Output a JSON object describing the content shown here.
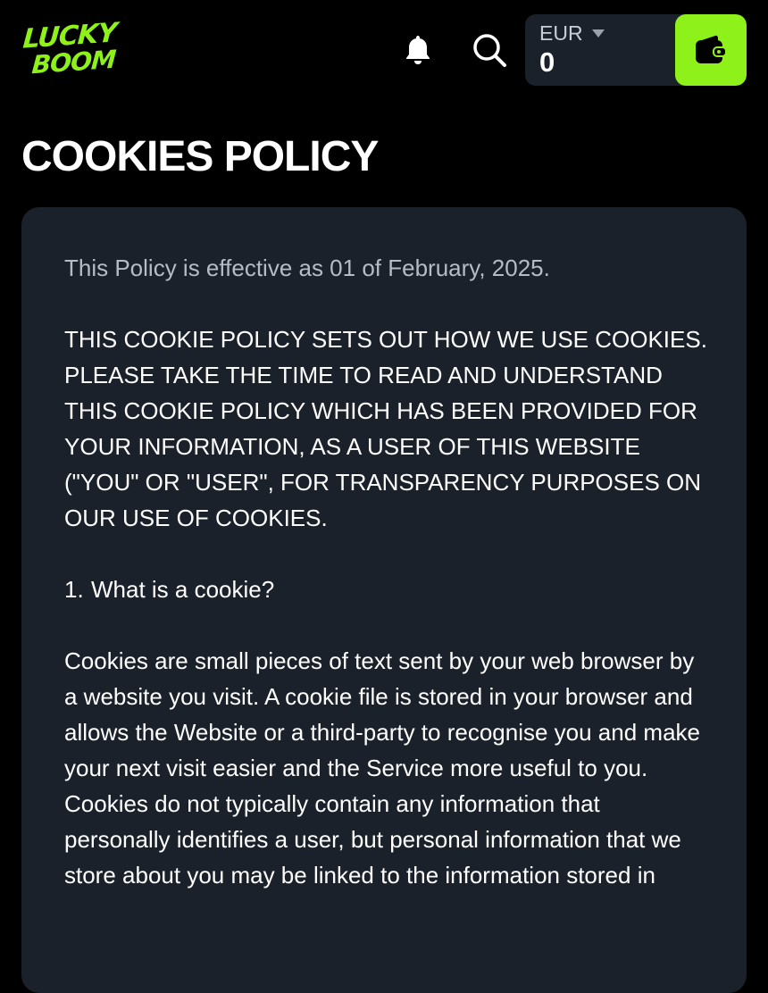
{
  "header": {
    "logo": {
      "line1": "LUCKY",
      "line2": "BOOM"
    },
    "bell_icon": "bell-icon",
    "search_icon": "search-icon",
    "wallet": {
      "currency": "EUR",
      "balance": "0",
      "wallet_icon": "wallet-icon",
      "accent_color": "#8ef21a"
    }
  },
  "page": {
    "title": "COOKIES POLICY",
    "effective": "This Policy is effective as 01 of February, 2025.",
    "intro_caps": "THIS COOKIE POLICY SETS OUT HOW WE USE COOKIES. PLEASE TAKE THE TIME TO READ AND UNDERSTAND THIS COOKIE POLICY WHICH HAS BEEN PROVIDED FOR YOUR INFORMATION, AS A USER OF THIS WEBSITE (\"YOU\" OR \"USER\", FOR TRANSPARENCY PURPOSES ON OUR USE OF COOKIES.",
    "section1": {
      "number": "1.",
      "heading": "What is a cookie?"
    },
    "section1_body": "Cookies are small pieces of text sent by your web browser by a website you visit. A cookie file is stored in your browser and allows the Website or a third-party to recognise you and make your next visit easier and the Service more useful to you. Cookies do not typically contain any information that personally identifies a user, but personal information that we store about you may be linked to the information stored in"
  },
  "colors": {
    "background": "#000000",
    "card": "#1b212b",
    "accent": "#8ef21a",
    "muted_text": "#b6bcc6"
  }
}
